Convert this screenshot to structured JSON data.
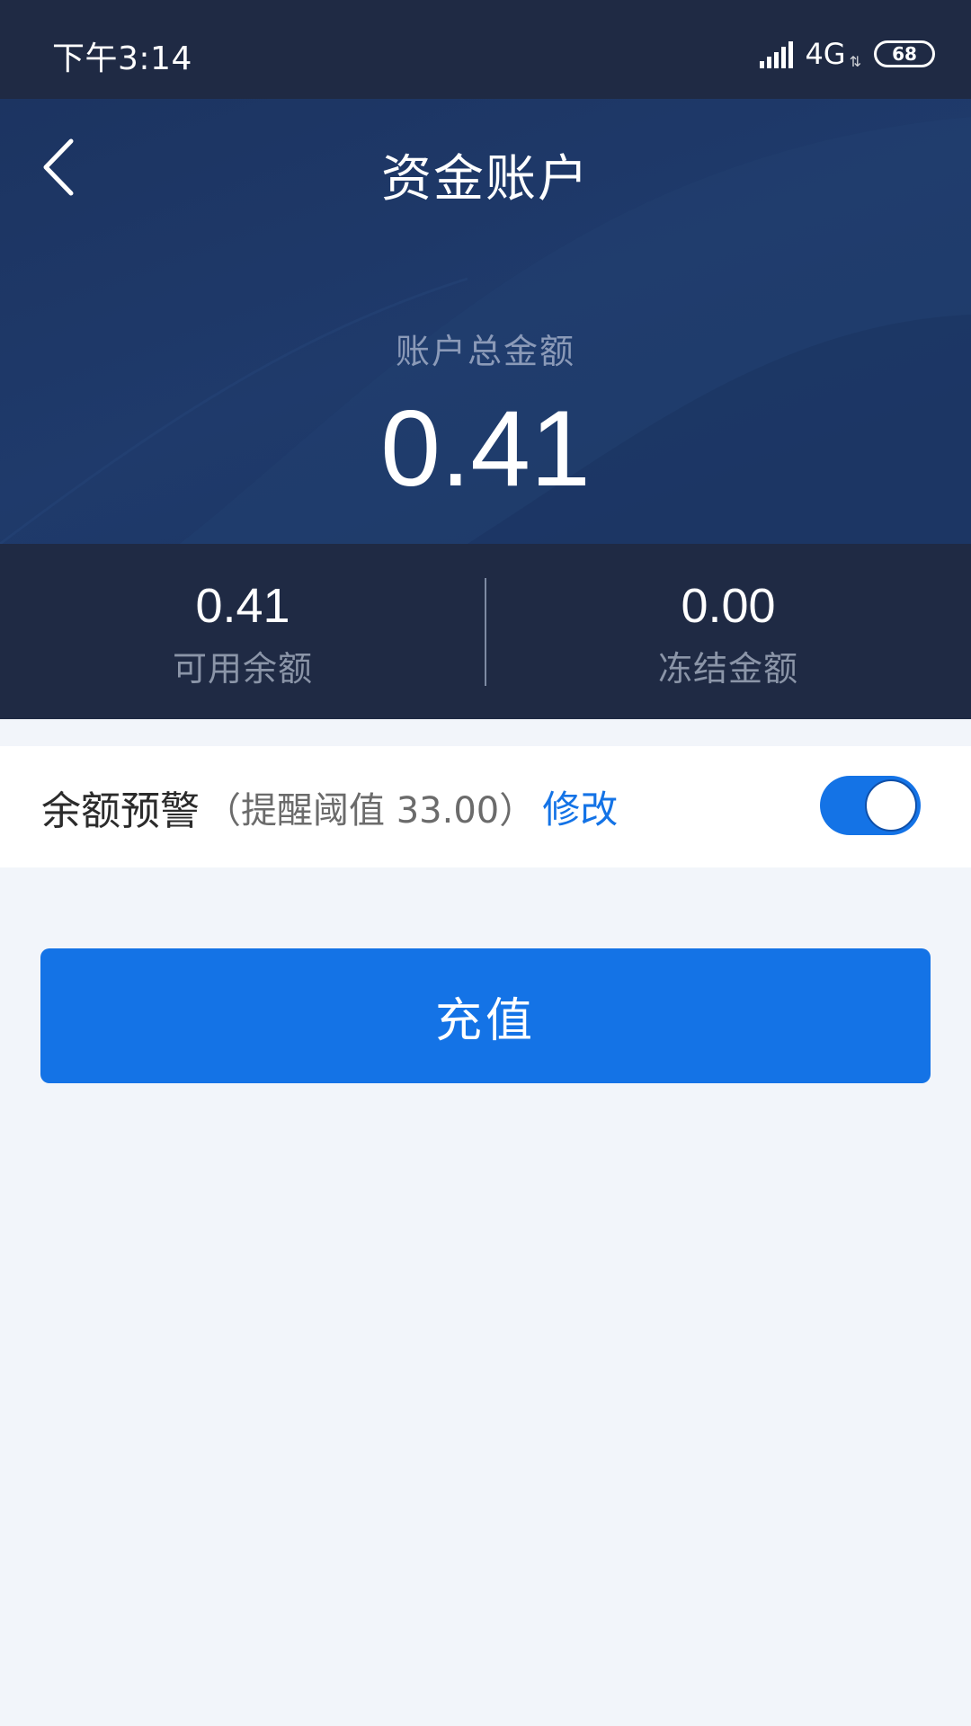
{
  "status_bar": {
    "time": "下午3:14",
    "network": "4G",
    "battery": "68",
    "icons": [
      "signal-icon",
      "battery-icon"
    ]
  },
  "header": {
    "title": "资金账户",
    "back_icon": "chevron-left-icon"
  },
  "account": {
    "total_label": "账户总金额",
    "total_amount": "0.41",
    "available": {
      "value": "0.41",
      "label": "可用余额"
    },
    "frozen": {
      "value": "0.00",
      "label": "冻结金额"
    }
  },
  "alert": {
    "title": "余额预警",
    "threshold_text": "（提醒阈值 33.00）",
    "edit_label": "修改",
    "enabled": true
  },
  "actions": {
    "recharge_label": "充值"
  },
  "colors": {
    "accent": "#1473e6",
    "header_bg": "#1f3a6b",
    "status_bg": "#1f2a44",
    "page_bg": "#f2f5fa"
  }
}
